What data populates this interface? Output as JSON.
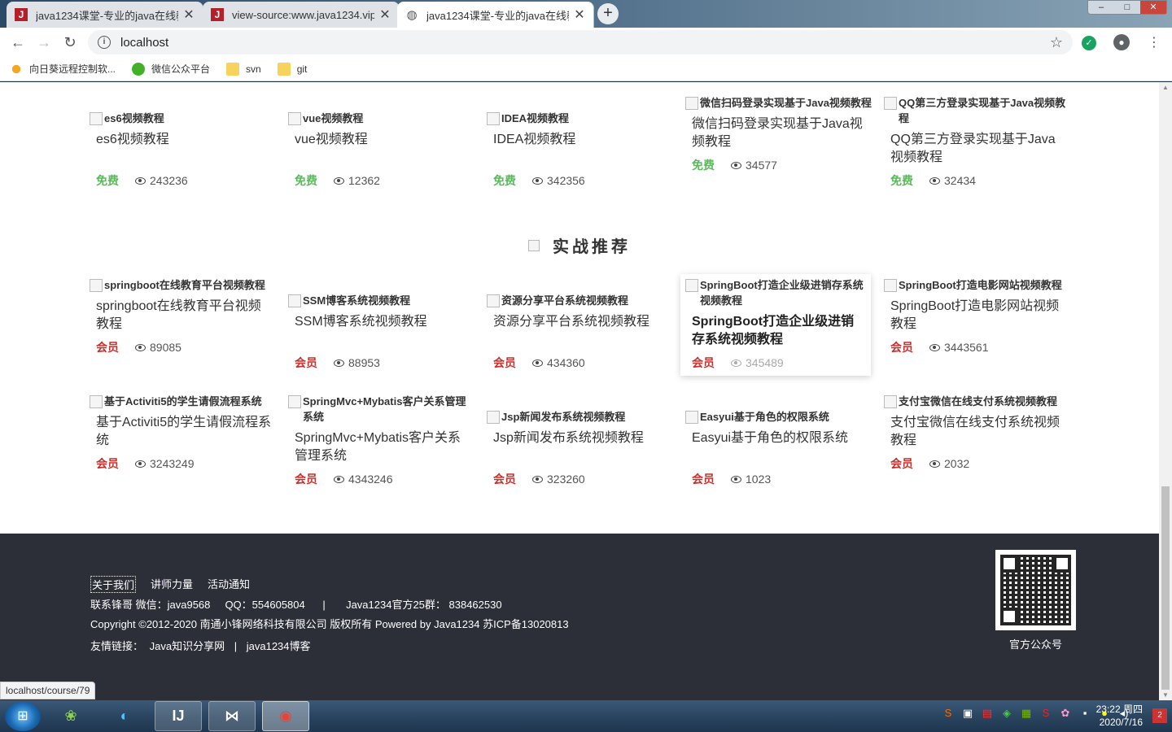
{
  "browser": {
    "tabs": [
      {
        "title": "java1234课堂-专业的java在线教",
        "icon": "J",
        "active": false
      },
      {
        "title": "view-source:www.java1234.vip",
        "icon": "J",
        "active": false
      },
      {
        "title": "java1234课堂-专业的java在线教",
        "icon": "globe",
        "active": true
      }
    ],
    "new_tab": "+",
    "window_controls": {
      "min": "–",
      "max": "□",
      "close": "✕"
    },
    "url": "localhost",
    "bookmarks": [
      {
        "label": "向日葵远程控制软...",
        "icon": "sunflower-icon"
      },
      {
        "label": "微信公众平台",
        "icon": "wechat-icon"
      },
      {
        "label": "svn",
        "icon": "folder-icon"
      },
      {
        "label": "git",
        "icon": "folder-icon"
      }
    ]
  },
  "free_courses": [
    {
      "alt": "es6视频教程",
      "title": "es6视频教程",
      "badge": "免费",
      "views": "243236"
    },
    {
      "alt": "vue视频教程",
      "title": "vue视频教程",
      "badge": "免费",
      "views": "12362"
    },
    {
      "alt": "IDEA视频教程",
      "title": "IDEA视频教程",
      "badge": "免费",
      "views": "342356"
    },
    {
      "alt": "微信扫码登录实现基于Java视频教程",
      "title": "微信扫码登录实现基于Java视频教程",
      "badge": "免费",
      "views": "34577"
    },
    {
      "alt": "QQ第三方登录实现基于Java视频教程",
      "title": "QQ第三方登录实现基于Java视频教程",
      "badge": "免费",
      "views": "32434"
    }
  ],
  "section": {
    "title": "实战推荐"
  },
  "practice_courses": [
    {
      "alt": "springboot在线教育平台视频教程",
      "title": "springboot在线教育平台视频教程",
      "badge": "会员",
      "views": "89085"
    },
    {
      "alt": "SSM博客系统视频教程",
      "title": "SSM博客系统视频教程",
      "badge": "会员",
      "views": "88953"
    },
    {
      "alt": "资源分享平台系统视频教程",
      "title": "资源分享平台系统视频教程",
      "badge": "会员",
      "views": "434360"
    },
    {
      "alt": "SpringBoot打造企业级进销存系统视频教程",
      "title": "SpringBoot打造企业级进销存系统视频教程",
      "badge": "会员",
      "views": "345489"
    },
    {
      "alt": "SpringBoot打造电影网站视频教程",
      "title": "SpringBoot打造电影网站视频教程",
      "badge": "会员",
      "views": "3443561"
    },
    {
      "alt": "基于Activiti5的学生请假流程系统",
      "title": "基于Activiti5的学生请假流程系统",
      "badge": "会员",
      "views": "3243249"
    },
    {
      "alt": "SpringMvc+Mybatis客户关系管理系统",
      "title": "SpringMvc+Mybatis客户关系管理系统",
      "badge": "会员",
      "views": "4343246"
    },
    {
      "alt": "Jsp新闻发布系统视频教程",
      "title": "Jsp新闻发布系统视频教程",
      "badge": "会员",
      "views": "323260"
    },
    {
      "alt": "Easyui基于角色的权限系统",
      "title": "Easyui基于角色的权限系统",
      "badge": "会员",
      "views": "1023"
    },
    {
      "alt": "支付宝微信在线支付系统视频教程",
      "title": "支付宝微信在线支付系统视频教程",
      "badge": "会员",
      "views": "2032"
    }
  ],
  "footer": {
    "links": [
      "关于我们",
      "讲师力量",
      "活动通知"
    ],
    "contact": "联系锋哥 微信：java9568     QQ：554605804      |       Java1234官方25群： 838462530",
    "copyright": "Copyright ©2012-2020 南通小锋网络科技有限公司 版权所有 Powered by Java1234 苏ICP备13020813",
    "friend_label": "友情链接：",
    "friend_links": [
      "Java知识分享网",
      "java1234博客"
    ],
    "friend_sep": "|",
    "qr_label": "官方公众号"
  },
  "status_url": "localhost/course/79",
  "taskbar": {
    "clock_time": "23:22 周四",
    "clock_date": "2020/7/16",
    "notification_count": "2"
  },
  "colors": {
    "free": "#5cb85c",
    "vip": "#c9302c",
    "footer_bg": "#2c2e38"
  }
}
